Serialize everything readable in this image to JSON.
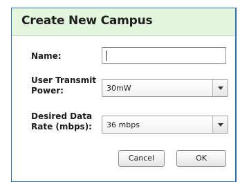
{
  "dialog": {
    "title": "Create New Campus",
    "name_label": "Name:",
    "name_value": "",
    "power_label": [
      "User Transmit",
      "Power:"
    ],
    "power_value": "30mW",
    "rate_label": [
      "Desired Data",
      "Rate (mbps):"
    ],
    "rate_value": "36 mbps",
    "cancel_label": "Cancel",
    "ok_label": "OK"
  },
  "colors": {
    "title_bar": "#e2f5dd",
    "border": "#2f6fb1"
  },
  "icons": [
    "dropdown-arrow-icon"
  ]
}
